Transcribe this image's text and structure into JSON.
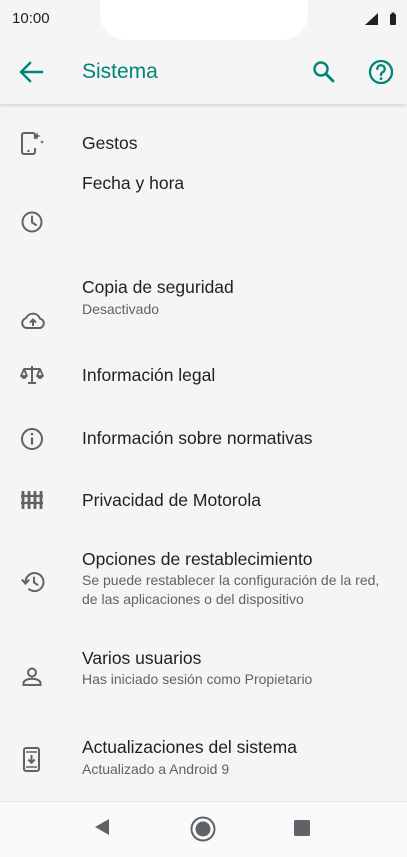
{
  "status_bar": {
    "time": "10:00"
  },
  "app_bar": {
    "title": "Sistema",
    "accent_color": "#008577",
    "back_icon": "arrow-back-icon",
    "search_icon": "search-icon",
    "help_icon": "help-icon"
  },
  "items": [
    {
      "icon": "gestures-icon",
      "label": "Gestos"
    },
    {
      "icon": "clock-icon",
      "label": "Fecha y hora"
    },
    {
      "icon": "cloud-backup-icon",
      "label": "Copia de seguridad",
      "sub": "Desactivado"
    },
    {
      "icon": "legal-scale-icon",
      "label": "Información legal"
    },
    {
      "icon": "info-icon",
      "label": "Información sobre normativas"
    },
    {
      "icon": "privacy-fence-icon",
      "label": "Privacidad de Motorola"
    },
    {
      "icon": "restore-icon",
      "label": "Opciones de restablecimiento",
      "sub": "Se puede restablecer la configuración de la red, de las aplicaciones o del dispositivo"
    },
    {
      "icon": "person-icon",
      "label": "Varios usuarios",
      "sub": "Has iniciado sesión como Propietario"
    },
    {
      "icon": "system-update-icon",
      "label": "Actualizaciones del sistema",
      "sub": "Actualizado a Android 9"
    }
  ],
  "nav_bar": {
    "back": "nav-back-icon",
    "home": "nav-home-icon",
    "recents": "nav-recents-icon"
  }
}
